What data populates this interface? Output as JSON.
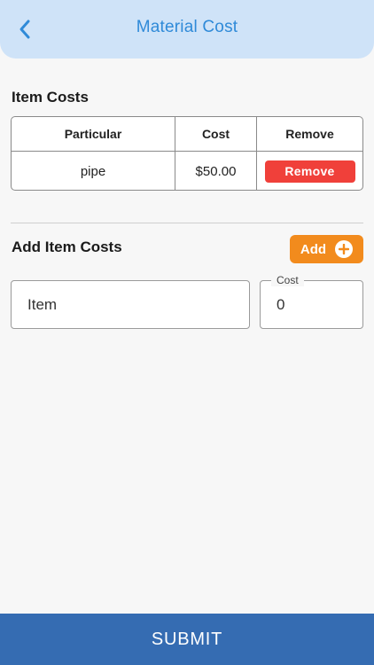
{
  "header": {
    "title": "Material Cost",
    "back_icon": "chevron-left-icon",
    "background_color": "#cfe3f8",
    "title_color": "#2f8ad8"
  },
  "item_costs": {
    "title": "Item Costs",
    "columns": [
      "Particular",
      "Cost",
      "Remove"
    ],
    "rows": [
      {
        "particular": "pipe",
        "cost": "$50.00",
        "remove_label": "Remove"
      }
    ],
    "remove_color": "#f0403a"
  },
  "add_item_costs": {
    "title": "Add Item Costs",
    "add_label": "Add",
    "add_icon": "plus-circle-icon",
    "add_color": "#f28b1d",
    "item_field": {
      "placeholder": "Item",
      "value": ""
    },
    "cost_field": {
      "label": "Cost",
      "value": "0"
    }
  },
  "footer": {
    "submit_label": "SUBMIT",
    "submit_color": "#356cb2"
  }
}
